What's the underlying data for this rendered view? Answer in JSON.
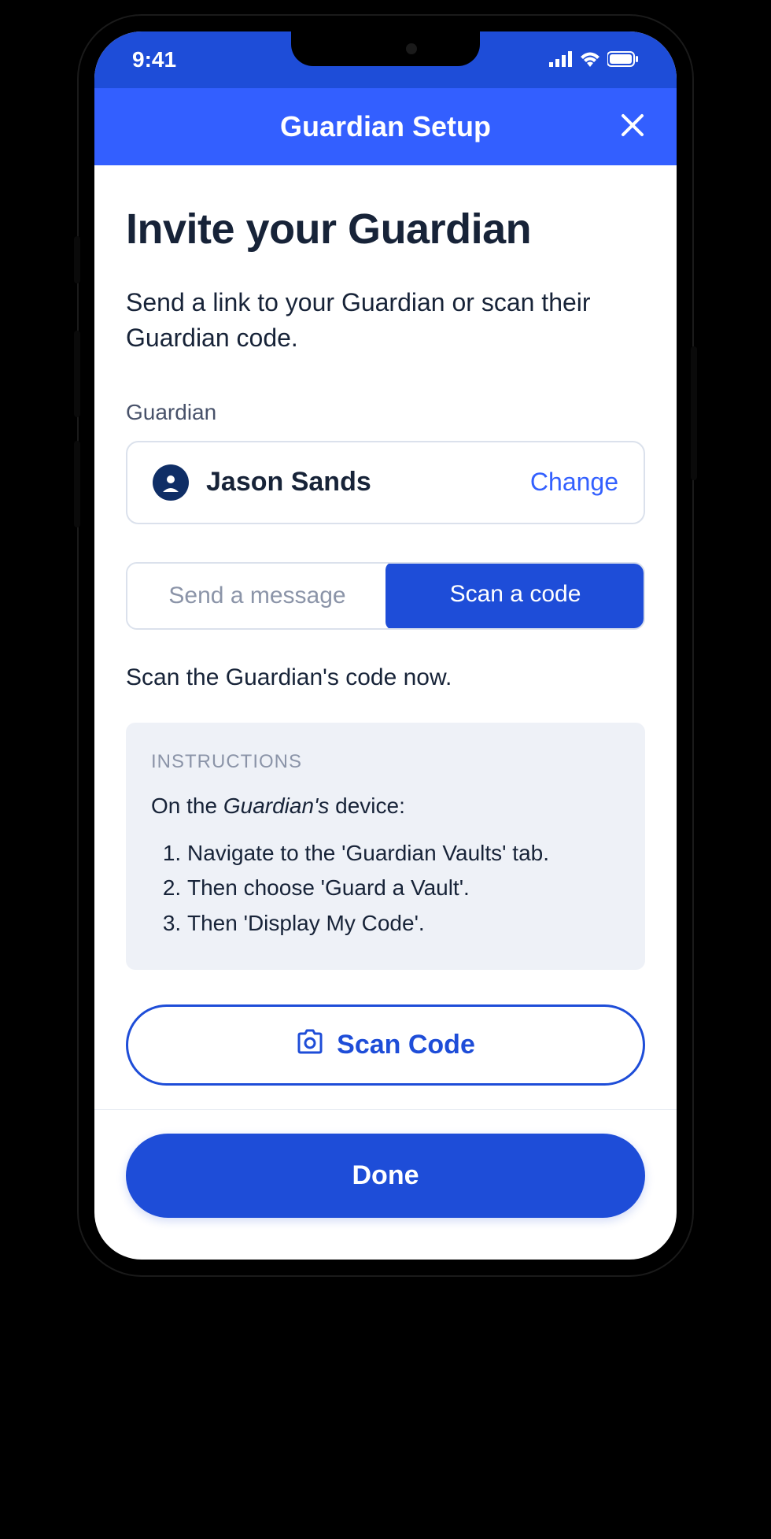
{
  "status_bar": {
    "time": "9:41"
  },
  "nav": {
    "title": "Guardian Setup"
  },
  "page": {
    "title": "Invite your Guardian",
    "subtitle": "Send a link to your Guardian or scan their Guardian code."
  },
  "guardian": {
    "field_label": "Guardian",
    "name": "Jason Sands",
    "change_label": "Change"
  },
  "segmented": {
    "send_message": "Send a message",
    "scan_code": "Scan a code"
  },
  "scan_prompt": "Scan the Guardian's code now.",
  "instructions": {
    "title": "INSTRUCTIONS",
    "intro_prefix": "On the ",
    "intro_em": "Guardian's",
    "intro_suffix": " device:",
    "steps": [
      "Navigate to the 'Guardian Vaults' tab.",
      "Then choose 'Guard a Vault'.",
      "Then 'Display My Code'."
    ]
  },
  "buttons": {
    "scan_code": "Scan Code",
    "done": "Done"
  }
}
